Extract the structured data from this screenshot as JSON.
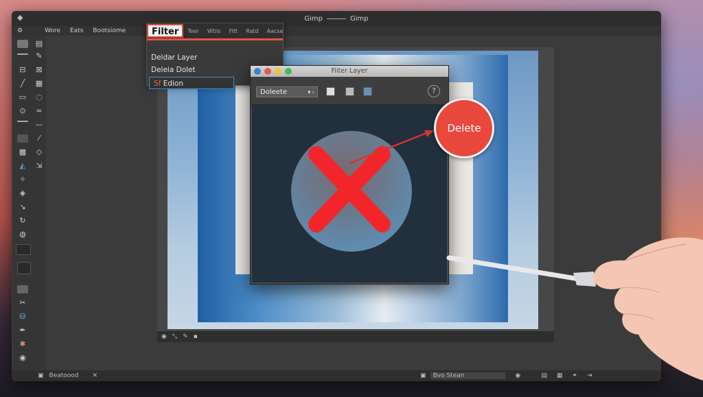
{
  "window": {
    "title_left": "Gimp",
    "title_right": "Gimp"
  },
  "menubar": {
    "items": [
      "Wore",
      "Eats",
      "Bootsiome"
    ]
  },
  "menu_panel": {
    "tabs": [
      "Filter",
      "Teer",
      "Wtiis",
      "Fitt",
      "Ratd",
      "Aacse"
    ],
    "items": [
      "Deldar Layer",
      "Deleia Dolet",
      "Edion"
    ],
    "selected_prefix": "Sf"
  },
  "dialog": {
    "title": "Fiiter Layer",
    "select_value": "Doleete",
    "help_label": "?"
  },
  "callout": {
    "label": "Delete"
  },
  "canvas_status": {
    "zoom": ""
  },
  "bottombar": {
    "left_label": "Beatoood",
    "mid_label": "Bvo Stean"
  },
  "colors": {
    "accent": "#e9483d",
    "menu_highlight": "#e8553f",
    "selection": "#3d8fd6"
  },
  "icons": [
    "app-icon",
    "delete-x-icon",
    "help-icon",
    "pen-icon"
  ]
}
